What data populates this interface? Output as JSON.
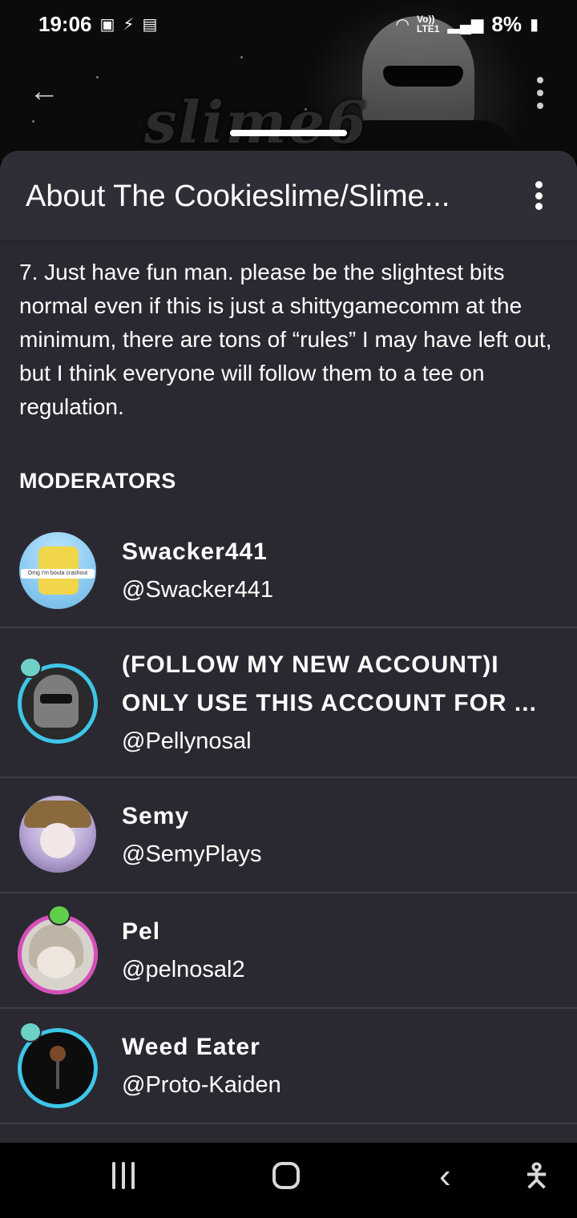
{
  "status_bar": {
    "time": "19:06",
    "network": "LTE1",
    "volte": "Vo))",
    "battery": "8%"
  },
  "banner": {
    "text": "slime6"
  },
  "sheet": {
    "title": "About The Cookieslime/Slime...",
    "rule_text": "7. Just have fun man. please be the slightest bits normal even if this is just a shittygamecomm at the minimum, there are tons of “rules” I may have left out, but I think everyone will follow them to a tee on regulation.",
    "moderators_heading": "MODERATORS",
    "moderators": [
      {
        "name": "Swacker441",
        "handle": "@Swacker441"
      },
      {
        "name": "(FOLLOW MY NEW ACCOUNT)I ONLY USE THIS ACCOUNT FOR ...",
        "handle": "@Pellynosal"
      },
      {
        "name": "Semy",
        "handle": "@SemyPlays"
      },
      {
        "name": "Pel",
        "handle": "@pelnosal2"
      },
      {
        "name": "Weed Eater",
        "handle": "@Proto-Kaiden"
      }
    ]
  },
  "avatar_caption": "Omg I'm bouta crashout",
  "icons": {
    "back": "arrow-left-icon",
    "more": "more-vertical-icon",
    "nav_recent": "recent-apps-icon",
    "nav_home": "home-icon",
    "nav_back": "chevron-left-icon",
    "accessibility": "accessibility-icon"
  }
}
